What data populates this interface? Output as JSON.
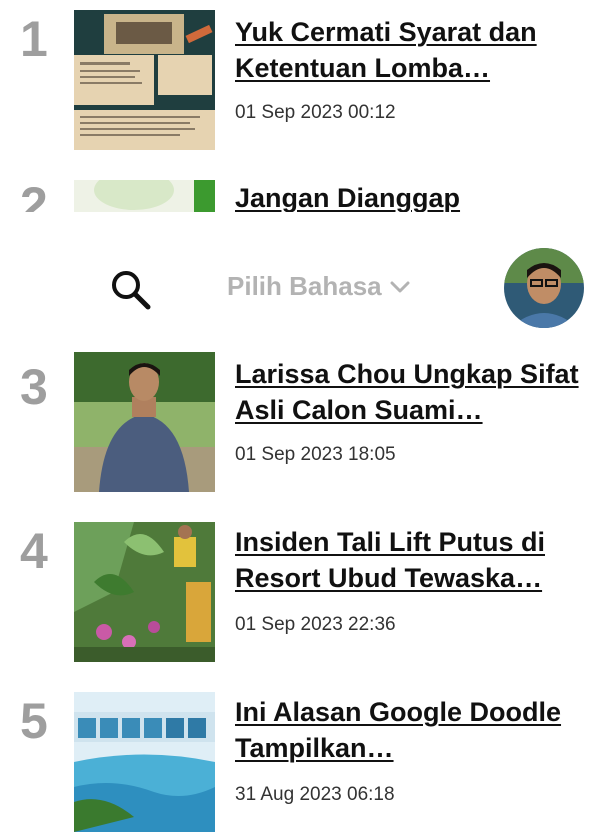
{
  "articles": [
    {
      "rank": "1",
      "title": "Yuk Cermati Syarat dan Ketentuan Lomba…",
      "date": "01 Sep 2023 00:12"
    },
    {
      "rank": "2",
      "title": "Jangan Dianggap",
      "date": ""
    },
    {
      "rank": "3",
      "title": "Larissa Chou Ungkap Sifat Asli Calon Suami…",
      "date": "01 Sep 2023 18:05"
    },
    {
      "rank": "4",
      "title": "Insiden Tali Lift Putus di Resort Ubud Tewaska…",
      "date": "01 Sep 2023 22:36"
    },
    {
      "rank": "5",
      "title": "Ini Alasan Google Doodle Tampilkan…",
      "date": "31 Aug 2023 06:18"
    }
  ],
  "navbar": {
    "language_label": "Pilih Bahasa",
    "search_icon": "search-icon",
    "chevron_icon": "chevron-down-icon"
  },
  "colors": {
    "rank": "#9e9e9e",
    "title": "#111111",
    "language": "#b3b3b3"
  }
}
